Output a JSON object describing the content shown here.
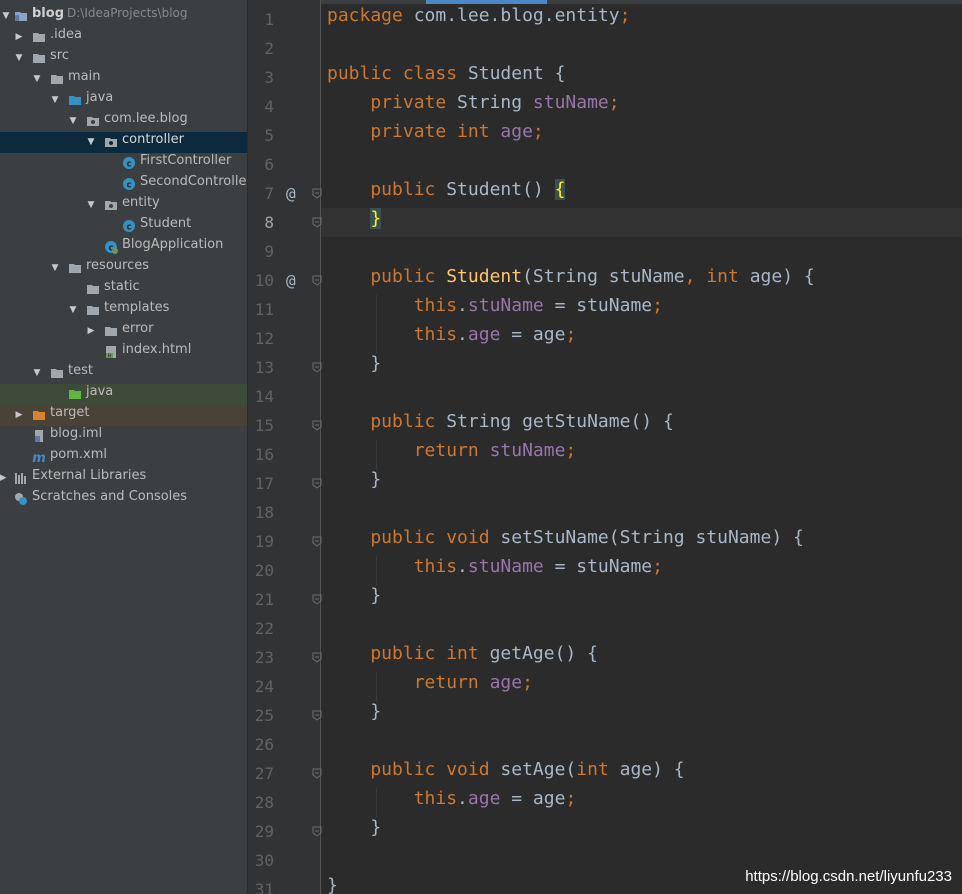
{
  "project_tree": {
    "root": {
      "label": "blog",
      "path": "D:\\IdeaProjects\\blog"
    },
    "items": [
      {
        "label": ".idea"
      },
      {
        "label": "src"
      },
      {
        "label": "main"
      },
      {
        "label": "java"
      },
      {
        "label": "com.lee.blog"
      },
      {
        "label": "controller"
      },
      {
        "label": "FirstController"
      },
      {
        "label": "SecondController"
      },
      {
        "label": "entity"
      },
      {
        "label": "Student"
      },
      {
        "label": "BlogApplication"
      },
      {
        "label": "resources"
      },
      {
        "label": "static"
      },
      {
        "label": "templates"
      },
      {
        "label": "error"
      },
      {
        "label": "index.html"
      },
      {
        "label": "test"
      },
      {
        "label": "java"
      },
      {
        "label": "target"
      },
      {
        "label": "blog.iml"
      },
      {
        "label": "pom.xml"
      },
      {
        "label": "External Libraries"
      },
      {
        "label": "Scratches and Consoles"
      }
    ]
  },
  "editor": {
    "current_line": 8,
    "line_numbers": [
      "1",
      "2",
      "3",
      "4",
      "5",
      "6",
      "7",
      "8",
      "9",
      "10",
      "11",
      "12",
      "13",
      "14",
      "15",
      "16",
      "17",
      "18",
      "19",
      "20",
      "21",
      "22",
      "23",
      "24",
      "25",
      "26",
      "27",
      "28",
      "29",
      "30",
      "31"
    ],
    "gutter_marks": [
      {
        "line": 7,
        "symbol": "@"
      },
      {
        "line": 10,
        "symbol": "@"
      }
    ],
    "fold_lines": [
      7,
      8,
      10,
      13,
      15,
      17,
      19,
      21,
      23,
      25,
      27,
      29
    ],
    "lines": [
      [
        {
          "t": "package ",
          "c": "kw"
        },
        {
          "t": "com.lee.blog.entity",
          "c": "id"
        },
        {
          "t": ";",
          "c": "kw"
        }
      ],
      [],
      [
        {
          "t": "public class ",
          "c": "kw"
        },
        {
          "t": "Student {",
          "c": "id"
        }
      ],
      [
        {
          "t": "    private ",
          "c": "kw"
        },
        {
          "t": "String ",
          "c": "id"
        },
        {
          "t": "stuName",
          "c": "fld"
        },
        {
          "t": ";",
          "c": "kw"
        }
      ],
      [
        {
          "t": "    private int ",
          "c": "kw"
        },
        {
          "t": "age",
          "c": "fld"
        },
        {
          "t": ";",
          "c": "kw"
        }
      ],
      [],
      [
        {
          "t": "    public ",
          "c": "kw"
        },
        {
          "t": "Student",
          "c": "decl"
        },
        {
          "t": "() ",
          "c": "id"
        },
        {
          "t": "{",
          "c": "brace-hl"
        }
      ],
      [
        {
          "t": "    ",
          "c": "id"
        },
        {
          "t": "}",
          "c": "brace-hl"
        }
      ],
      [],
      [
        {
          "t": "    public ",
          "c": "kw"
        },
        {
          "t": "Student",
          "c": "fn"
        },
        {
          "t": "(String stuName",
          "c": "id"
        },
        {
          "t": ", ",
          "c": "kw"
        },
        {
          "t": "int ",
          "c": "kw"
        },
        {
          "t": "age) {",
          "c": "id"
        }
      ],
      [
        {
          "t": "        this",
          "c": "kw"
        },
        {
          "t": ".",
          "c": "id"
        },
        {
          "t": "stuName",
          "c": "fld"
        },
        {
          "t": " = stuName",
          "c": "id"
        },
        {
          "t": ";",
          "c": "kw"
        }
      ],
      [
        {
          "t": "        this",
          "c": "kw"
        },
        {
          "t": ".",
          "c": "id"
        },
        {
          "t": "age",
          "c": "fld"
        },
        {
          "t": " = age",
          "c": "id"
        },
        {
          "t": ";",
          "c": "kw"
        }
      ],
      [
        {
          "t": "    }",
          "c": "id"
        }
      ],
      [],
      [
        {
          "t": "    public ",
          "c": "kw"
        },
        {
          "t": "String ",
          "c": "id"
        },
        {
          "t": "getStuName",
          "c": "decl"
        },
        {
          "t": "() {",
          "c": "id"
        }
      ],
      [
        {
          "t": "        return ",
          "c": "kw"
        },
        {
          "t": "stuName",
          "c": "fld"
        },
        {
          "t": ";",
          "c": "kw"
        }
      ],
      [
        {
          "t": "    }",
          "c": "id"
        }
      ],
      [],
      [
        {
          "t": "    public void ",
          "c": "kw"
        },
        {
          "t": "setStuName",
          "c": "decl"
        },
        {
          "t": "(String stuName) {",
          "c": "id"
        }
      ],
      [
        {
          "t": "        this",
          "c": "kw"
        },
        {
          "t": ".",
          "c": "id"
        },
        {
          "t": "stuName",
          "c": "fld"
        },
        {
          "t": " = stuName",
          "c": "id"
        },
        {
          "t": ";",
          "c": "kw"
        }
      ],
      [
        {
          "t": "    }",
          "c": "id"
        }
      ],
      [],
      [
        {
          "t": "    public int ",
          "c": "kw"
        },
        {
          "t": "getAge",
          "c": "decl"
        },
        {
          "t": "() {",
          "c": "id"
        }
      ],
      [
        {
          "t": "        return ",
          "c": "kw"
        },
        {
          "t": "age",
          "c": "fld"
        },
        {
          "t": ";",
          "c": "kw"
        }
      ],
      [
        {
          "t": "    }",
          "c": "id"
        }
      ],
      [],
      [
        {
          "t": "    public void ",
          "c": "kw"
        },
        {
          "t": "setAge",
          "c": "decl"
        },
        {
          "t": "(",
          "c": "id"
        },
        {
          "t": "int ",
          "c": "kw"
        },
        {
          "t": "age) {",
          "c": "id"
        }
      ],
      [
        {
          "t": "        this",
          "c": "kw"
        },
        {
          "t": ".",
          "c": "id"
        },
        {
          "t": "age",
          "c": "fld"
        },
        {
          "t": " = age",
          "c": "id"
        },
        {
          "t": ";",
          "c": "kw"
        }
      ],
      [
        {
          "t": "    }",
          "c": "id"
        }
      ],
      [],
      [
        {
          "t": "}",
          "c": "id"
        }
      ]
    ]
  },
  "watermark": "https://blog.csdn.net/liyunfu233",
  "colors": {
    "sidebar_bg": "#3c3f41",
    "editor_bg": "#2b2b2b",
    "keyword": "#cc7832",
    "field": "#9876aa",
    "method": "#ffc66d",
    "text": "#a9b7c6",
    "selection": "#0d293e"
  }
}
